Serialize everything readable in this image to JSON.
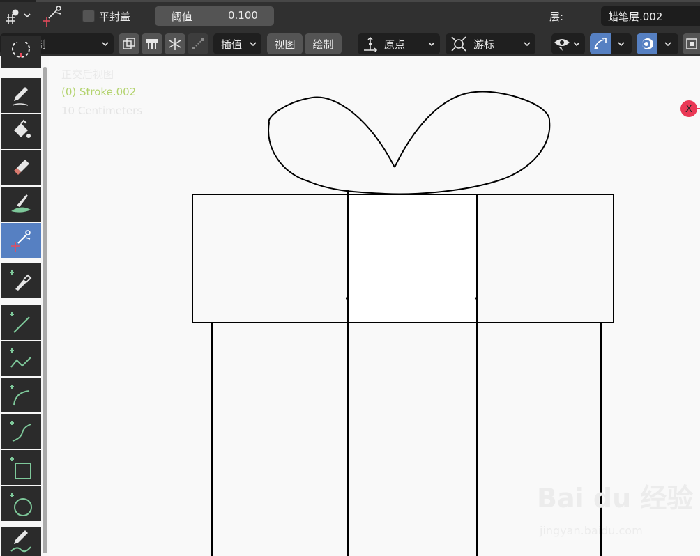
{
  "header": {
    "flat_caps_label": "平封盖",
    "flat_caps_checked": false,
    "threshold_label": "阈值",
    "threshold_value": "0.100",
    "layer_label": "层:",
    "layer_value": "蜡笔层.002"
  },
  "toolbar_row": {
    "mode_label": "绘制",
    "interpolate_label": "插值",
    "view_label": "视图",
    "draw_label": "绘制",
    "pivot_label": "原点",
    "cursor_label": "游标"
  },
  "viewport": {
    "view_name": "正交后视图",
    "object_name": "(0) Stroke.002",
    "units": "10 Centimeters",
    "axis_label": "X",
    "axis_color": "#ea3855",
    "object_text_color": "#b3d36e",
    "stroke_color": "#000000",
    "background_color": "#f9f9f9"
  },
  "tools": [
    {
      "icon": "pencil-draw-icon"
    },
    {
      "icon": "fill-bucket-icon"
    },
    {
      "icon": "eraser-icon"
    },
    {
      "icon": "tint-brush-icon"
    },
    {
      "icon": "cutter-icon",
      "active": true
    },
    {
      "icon": "eyedropper-icon"
    },
    {
      "icon": "line-icon"
    },
    {
      "icon": "polyline-icon"
    },
    {
      "icon": "arc-icon"
    },
    {
      "icon": "curve-icon"
    },
    {
      "icon": "box-icon"
    },
    {
      "icon": "circle-icon"
    },
    {
      "icon": "annotate-icon"
    }
  ],
  "accent_color": "#5680c2",
  "watermark": {
    "brand": "Bai du 经验",
    "url": "jingyan.baidu.com"
  }
}
